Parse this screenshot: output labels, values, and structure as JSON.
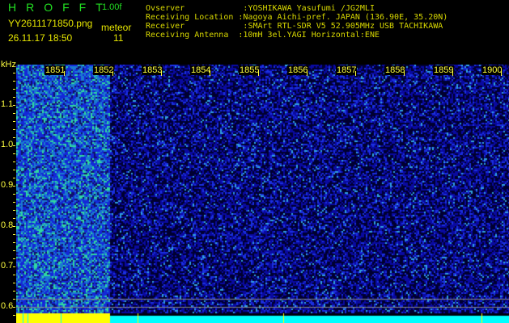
{
  "header": {
    "logo": "HROFFT",
    "version": "1.00f",
    "filename": "YY2611171850.png",
    "datetime": "26.11.17 18:50",
    "meteor_label": "meteor",
    "meteor_count": "11"
  },
  "info": [
    {
      "label": "Ovserver            ",
      "value": ":YOSHIKAWA Yasufumi /JG2MLI"
    },
    {
      "label": "Receiving Location ",
      "value": ":Nagoya Aichi-pref. JAPAN (136.90E, 35.20N)"
    },
    {
      "label": "Receiver            ",
      "value": ":SMArt RTL-SDR V5 52.905MHz USB TACHIKAWA"
    },
    {
      "label": "Receiving Antenna  ",
      "value": ":10mH 3el.YAGI Horizontal:ENE"
    }
  ],
  "axis": {
    "unit": "kHz",
    "time_labels": [
      "1851",
      "1852",
      "1853",
      "1854",
      "1855",
      "1856",
      "1857",
      "1858",
      "1859",
      "1900"
    ],
    "freq_labels": [
      "1.1",
      "1.0",
      "0.9",
      "0.8",
      "0.7",
      "0.6"
    ]
  },
  "colors": {
    "active": "#ffff00",
    "idle": "#00ffff",
    "bg": "#000000"
  }
}
